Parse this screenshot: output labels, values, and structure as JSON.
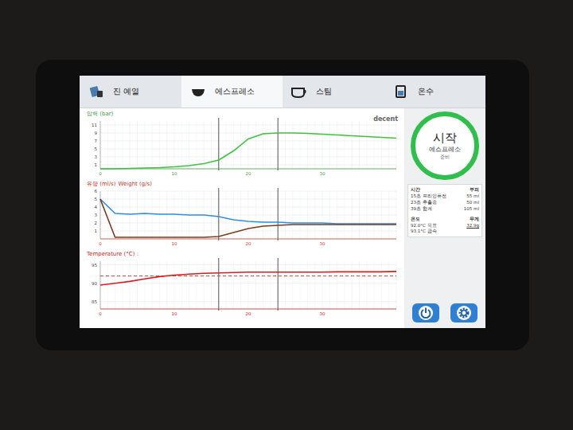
{
  "tabs": [
    {
      "label": "진 예열",
      "selected": false
    },
    {
      "label": "에스프레소",
      "selected": true
    },
    {
      "label": "스팀",
      "selected": false
    },
    {
      "label": "온수",
      "selected": false
    }
  ],
  "logo": "decent",
  "time_axis": {
    "min": 0,
    "max": 40,
    "ticks": [
      "0",
      "10",
      "20",
      "30"
    ],
    "markers": [
      16,
      24
    ]
  },
  "charts": [
    {
      "titles": [
        {
          "text": "압력 (bar)",
          "color": "#3a9a3a"
        }
      ],
      "axis_color": "#3a9a3a",
      "min": 0,
      "max": 12,
      "ticks": [
        "1",
        "3",
        "5",
        "7",
        "9",
        "11"
      ],
      "series": [
        {
          "color": "#3cc43c",
          "dashed": false,
          "values": [
            0,
            0,
            0.1,
            0.2,
            0.3,
            0.5,
            0.8,
            1.3,
            2.2,
            4.5,
            7.5,
            8.8,
            9,
            9,
            8.9,
            8.7,
            8.5,
            8.3,
            8.1,
            7.9,
            7.7
          ]
        }
      ]
    },
    {
      "titles": [
        {
          "text": "유량 (ml/s)",
          "color": "#c0392b"
        },
        {
          "text": "Weight (g/s)",
          "color": "#c0392b"
        }
      ],
      "axis_color": "#c0392b",
      "min": 0,
      "max": 6,
      "ticks": [
        "1",
        "2",
        "3",
        "4",
        "5",
        "6"
      ],
      "series": [
        {
          "color": "#2f8fe0",
          "dashed": false,
          "values": [
            5,
            3.2,
            3.1,
            3.2,
            3.1,
            3.1,
            3.0,
            3.0,
            2.8,
            2.4,
            2.2,
            2.1,
            2.1,
            2.0,
            2.0,
            2.0,
            1.9,
            1.9,
            1.9,
            1.9,
            1.9
          ]
        },
        {
          "color": "#7a3b1e",
          "dashed": false,
          "values": [
            5,
            0.2,
            0.2,
            0.2,
            0.2,
            0.2,
            0.2,
            0.2,
            0.3,
            0.8,
            1.3,
            1.6,
            1.7,
            1.8,
            1.8,
            1.8,
            1.8,
            1.8,
            1.8,
            1.8,
            1.8
          ]
        }
      ]
    },
    {
      "titles": [
        {
          "text": "Temperature (°C) :",
          "color": "#d02020"
        }
      ],
      "axis_color": "#d02020",
      "min": 83,
      "max": 96,
      "ticks": [
        "85",
        "90",
        "95"
      ],
      "series": [
        {
          "color": "#e03030",
          "dashed": true,
          "values": [
            92,
            92,
            92,
            92,
            92,
            92,
            92,
            92,
            92,
            92,
            92,
            92,
            92,
            92,
            92,
            92,
            92,
            92,
            92,
            92,
            92
          ]
        },
        {
          "color": "#d81e1e",
          "dashed": false,
          "values": [
            89.5,
            90,
            90.5,
            91.2,
            91.8,
            92.2,
            92.5,
            92.7,
            92.8,
            92.9,
            93,
            93,
            93,
            93,
            93,
            93,
            93.1,
            93.1,
            93.1,
            93.1,
            93.2
          ]
        }
      ]
    }
  ],
  "status": {
    "title": "시작",
    "subtitle": "에스프레소",
    "state": "준비"
  },
  "info": {
    "headers": [
      "시간",
      "부피"
    ],
    "rows": [
      {
        "time": "15초 프리인퓨전",
        "volume": "55 ml"
      },
      {
        "time": "23초 추출중",
        "volume": "50 ml"
      },
      {
        "time": "39초 합계",
        "volume": "105 ml"
      }
    ],
    "temp_header": "온도",
    "weight_header": "무게",
    "temps": [
      "92.0°C 목표",
      "93.1°C 급속"
    ],
    "weight": "32.9g"
  }
}
